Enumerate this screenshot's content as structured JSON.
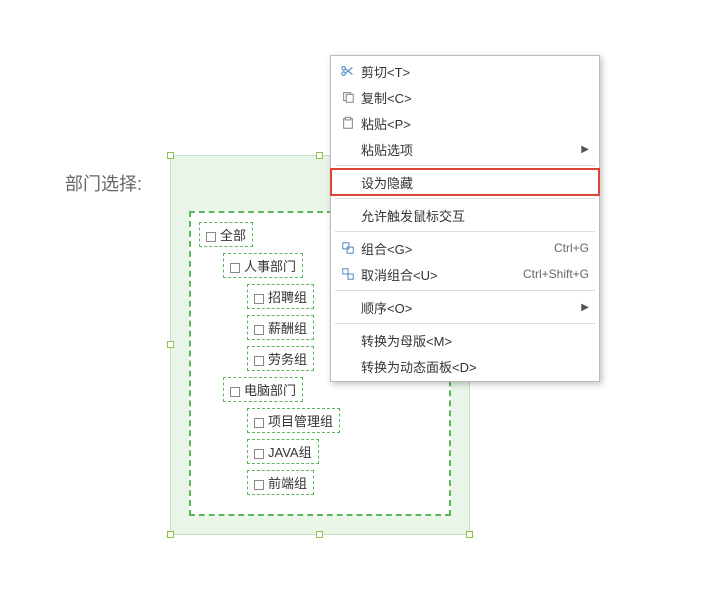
{
  "label": "部门选择:",
  "tree": [
    {
      "label": "全部",
      "level": 0
    },
    {
      "label": "人事部门",
      "level": 1
    },
    {
      "label": "招聘组",
      "level": 2
    },
    {
      "label": "薪酬组",
      "level": 2
    },
    {
      "label": "劳务组",
      "level": 2
    },
    {
      "label": "电脑部门",
      "level": 1
    },
    {
      "label": "项目管理组",
      "level": 2
    },
    {
      "label": "JAVA组",
      "level": 2
    },
    {
      "label": "前端组",
      "level": 2
    }
  ],
  "menu": [
    {
      "type": "item",
      "icon": "cut",
      "label": "剪切<T>"
    },
    {
      "type": "item",
      "icon": "copy",
      "label": "复制<C>"
    },
    {
      "type": "item",
      "icon": "paste",
      "label": "粘贴<P>"
    },
    {
      "type": "item",
      "label": "粘贴选项",
      "arrow": true
    },
    {
      "type": "sep"
    },
    {
      "type": "item",
      "label": "设为隐藏",
      "highlight": true
    },
    {
      "type": "sep"
    },
    {
      "type": "item",
      "label": "允许触发鼠标交互"
    },
    {
      "type": "sep"
    },
    {
      "type": "item",
      "icon": "group",
      "label": "组合<G>",
      "shortcut": "Ctrl+G"
    },
    {
      "type": "item",
      "icon": "ungroup",
      "label": "取消组合<U>",
      "shortcut": "Ctrl+Shift+G"
    },
    {
      "type": "sep"
    },
    {
      "type": "item",
      "label": "顺序<O>",
      "arrow": true
    },
    {
      "type": "sep"
    },
    {
      "type": "item",
      "label": "转换为母版<M>"
    },
    {
      "type": "item",
      "label": "转换为动态面板<D>"
    }
  ]
}
